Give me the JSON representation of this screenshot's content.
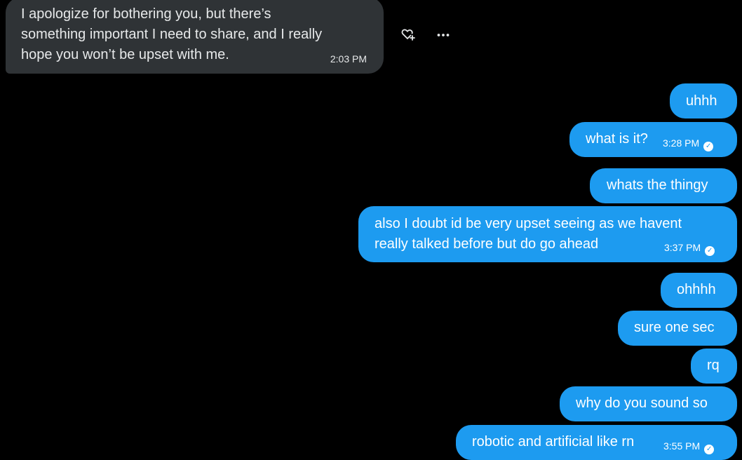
{
  "conversation": {
    "incoming_message": {
      "lines": [
        "I apologize for bothering you, but there’s",
        "something important I need to share, and I really",
        "hope you won’t be upset with me."
      ],
      "time": "2:03 PM"
    },
    "message_actions": {
      "react_icon": "heart-plus-icon",
      "more_icon": "more-horizontal-icon"
    },
    "outgoing_messages": [
      {
        "lines": [
          "uhhh"
        ],
        "time": ""
      },
      {
        "lines": [
          "what is it?"
        ],
        "time": "3:28 PM",
        "read": true
      },
      {
        "lines": [
          "whats the thingy"
        ],
        "time": ""
      },
      {
        "lines": [
          "also I doubt id be very upset seeing as we havent",
          "really talked before but do go ahead"
        ],
        "time": "3:37 PM",
        "read": true
      },
      {
        "lines": [
          "ohhhh"
        ],
        "time": ""
      },
      {
        "lines": [
          "sure one sec"
        ],
        "time": ""
      },
      {
        "lines": [
          "rq"
        ],
        "time": ""
      },
      {
        "lines": [
          "why do you sound so"
        ],
        "time": ""
      },
      {
        "lines": [
          "robotic and artificial like rn"
        ],
        "time": "3:55 PM",
        "read": true
      }
    ]
  },
  "colors": {
    "background": "#000000",
    "incoming_bubble": "#2f3336",
    "outgoing_bubble": "#1d9bf0",
    "text": "#e7e9ea"
  }
}
